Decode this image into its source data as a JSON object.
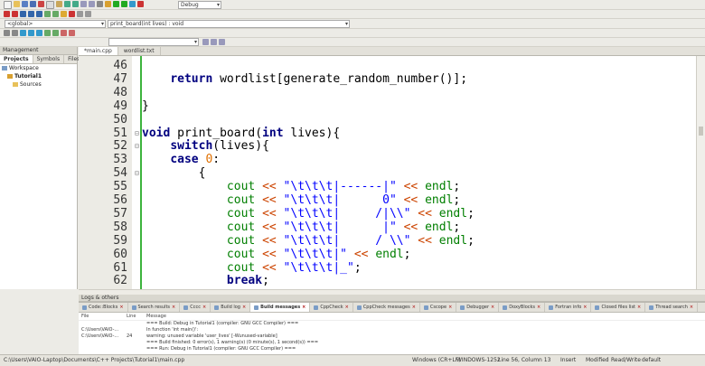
{
  "toolbar": {
    "build_target": "Debug",
    "scope": "<global>",
    "function": "print_board(int lives) : void"
  },
  "management": {
    "title": "Management",
    "tabs": [
      "Projects",
      "Symbols",
      "Files"
    ],
    "tree": [
      "Workspace",
      "Tutorial1",
      "Sources"
    ]
  },
  "editor": {
    "tabs": [
      "*main.cpp",
      "wordlist.txt"
    ],
    "lines": [
      {
        "n": "46",
        "html": ""
      },
      {
        "n": "47",
        "html": "    <span class='kw'>return</span> wordlist[generate_random_number()];"
      },
      {
        "n": "48",
        "html": ""
      },
      {
        "n": "49",
        "html": "}"
      },
      {
        "n": "50",
        "html": ""
      },
      {
        "n": "51",
        "html": "<span class='kw'>void</span> print_board(<span class='kw'>int</span> lives){"
      },
      {
        "n": "52",
        "html": "    <span class='kw'>switch</span>(lives){"
      },
      {
        "n": "53",
        "html": "    <span class='kw'>case</span> <span class='num'>0</span>:"
      },
      {
        "n": "54",
        "html": "        {"
      },
      {
        "n": "55",
        "html": "            <span class='idg'>cout</span> <span class='op'>&lt;&lt;</span> <span class='str'>\"\\t\\t\\t|------|\"</span> <span class='op'>&lt;&lt;</span> <span class='idg'>endl</span>;"
      },
      {
        "n": "56",
        "html": "            <span class='idg'>cout</span> <span class='op'>&lt;&lt;</span> <span class='str'>\"\\t\\t\\t|      0\"</span> <span class='op'>&lt;&lt;</span> <span class='idg'>endl</span>;"
      },
      {
        "n": "57",
        "html": "            <span class='idg'>cout</span> <span class='op'>&lt;&lt;</span> <span class='str'>\"\\t\\t\\t|     /|\\\\\"</span> <span class='op'>&lt;&lt;</span> <span class='idg'>endl</span>;"
      },
      {
        "n": "58",
        "html": "            <span class='idg'>cout</span> <span class='op'>&lt;&lt;</span> <span class='str'>\"\\t\\t\\t|      |\"</span> <span class='op'>&lt;&lt;</span> <span class='idg'>endl</span>;"
      },
      {
        "n": "59",
        "html": "            <span class='idg'>cout</span> <span class='op'>&lt;&lt;</span> <span class='str'>\"\\t\\t\\t|     / \\\\\"</span> <span class='op'>&lt;&lt;</span> <span class='idg'>endl</span>;"
      },
      {
        "n": "60",
        "html": "            <span class='idg'>cout</span> <span class='op'>&lt;&lt;</span> <span class='str'>\"\\t\\t\\t|\"</span> <span class='op'>&lt;&lt;</span> <span class='idg'>endl</span>;"
      },
      {
        "n": "61",
        "html": "            <span class='idg'>cout</span> <span class='op'>&lt;&lt;</span> <span class='str'>\"\\t\\t\\t|_\"</span>;"
      },
      {
        "n": "62",
        "html": "            <span class='kw'>break</span>;"
      }
    ]
  },
  "logs": {
    "title": "Logs & others",
    "tabs": [
      "Code::Blocks",
      "Search results",
      "Cccc",
      "Build log",
      "Build messages",
      "CppCheck",
      "CppCheck messages",
      "Cscope",
      "Debugger",
      "DoxyBlocks",
      "Fortran info",
      "Closed files list",
      "Thread search"
    ],
    "active_tab": "Build messages",
    "headers": {
      "file": "File",
      "line": "Line",
      "message": "Message"
    },
    "rows": [
      {
        "file": "",
        "line": "",
        "message": "=== Build: Debug in Tutorial1 (compiler: GNU GCC Compiler) ==="
      },
      {
        "file": "C:\\Users\\VAIO-...",
        "line": "",
        "message": "In function 'int main()':"
      },
      {
        "file": "C:\\Users\\VAIO-...",
        "line": "24",
        "message": "warning: unused variable 'user_lives' [-Wunused-variable]"
      },
      {
        "file": "",
        "line": "",
        "message": "=== Build finished: 0 error(s), 1 warning(s) (0 minute(s), 1 second(s)) ==="
      },
      {
        "file": "",
        "line": "",
        "message": "=== Run: Debug in Tutorial1 (compiler: GNU GCC Compiler) ==="
      }
    ]
  },
  "status": {
    "path": "C:\\Users\\VAIO-Laptop\\Documents\\C++ Projects\\Tutorial1\\main.cpp",
    "eol": "Windows (CR+LF)",
    "encoding": "WINDOWS-1252",
    "position": "Line 56, Column 13",
    "mode": "Insert",
    "modified": "Modified",
    "access": "Read/Write",
    "profile": "default"
  }
}
